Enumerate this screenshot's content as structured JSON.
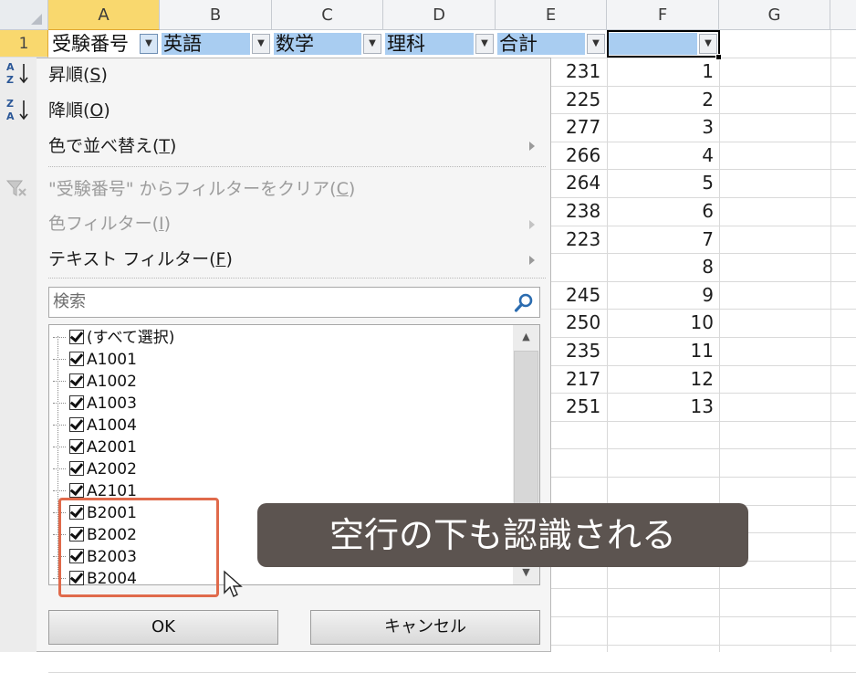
{
  "columns": [
    "A",
    "B",
    "C",
    "D",
    "E",
    "F",
    "G"
  ],
  "rows": {
    "header_row_number": "1"
  },
  "table_headers": [
    "受験番号",
    "英語",
    "数学",
    "理科",
    "合計",
    ""
  ],
  "column_e_values": [
    "231",
    "225",
    "277",
    "266",
    "264",
    "238",
    "223",
    "",
    "245",
    "250",
    "235",
    "217",
    "251"
  ],
  "column_f_values": [
    "1",
    "2",
    "3",
    "4",
    "5",
    "6",
    "7",
    "8",
    "9",
    "10",
    "11",
    "12",
    "13"
  ],
  "menu": {
    "sort_asc": {
      "label": "昇順(",
      "key": "S",
      "tail": ")"
    },
    "sort_desc": {
      "label": "降順(",
      "key": "O",
      "tail": ")"
    },
    "sort_color": {
      "label": "色で並べ替え(",
      "key": "T",
      "tail": ")"
    },
    "clear_filter": {
      "label": "\"受験番号\" からフィルターをクリア(",
      "key": "C",
      "tail": ")"
    },
    "color_filter": {
      "label": "色フィルター(",
      "key": "I",
      "tail": ")"
    },
    "text_filter": {
      "label": "テキスト フィルター(",
      "key": "F",
      "tail": ")"
    },
    "sort_asc_icon_top": "A",
    "sort_asc_icon_bottom": "Z",
    "sort_desc_icon_top": "Z",
    "sort_desc_icon_bottom": "A"
  },
  "search": {
    "placeholder": "検索"
  },
  "tree_items": [
    "(すべて選択)",
    "A1001",
    "A1002",
    "A1003",
    "A1004",
    "A2001",
    "A2002",
    "A2101",
    "B2001",
    "B2002",
    "B2003",
    "B2004"
  ],
  "buttons": {
    "ok": "OK",
    "cancel": "キャンセル"
  },
  "caption": "空行の下も認識される",
  "colors": {
    "selected_header": "#f9d86e",
    "table_header_fill": "#a9cdf1",
    "highlight": "#e06a4b",
    "caption_bg": "#5c5450"
  }
}
